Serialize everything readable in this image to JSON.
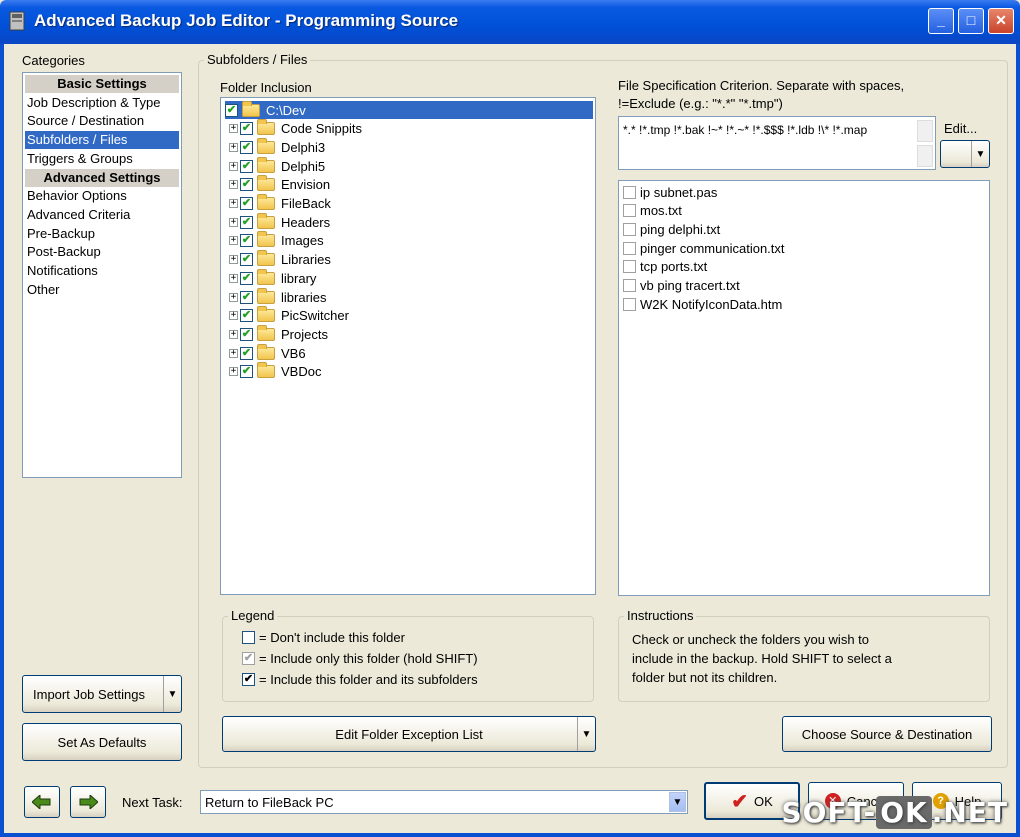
{
  "window": {
    "title": "Advanced Backup Job Editor - Programming Source",
    "minimize_glyph": "_",
    "maximize_glyph": "□",
    "close_glyph": "✕"
  },
  "categories": {
    "label": "Categories",
    "items": [
      {
        "label": "Basic Settings",
        "type": "header"
      },
      {
        "label": "Job Description & Type"
      },
      {
        "label": "Source / Destination"
      },
      {
        "label": "Subfolders / Files",
        "selected": true
      },
      {
        "label": "Triggers & Groups"
      },
      {
        "label": "Advanced Settings",
        "type": "header"
      },
      {
        "label": "Behavior Options"
      },
      {
        "label": "Advanced Criteria"
      },
      {
        "label": "Pre-Backup"
      },
      {
        "label": "Post-Backup"
      },
      {
        "label": "Notifications"
      },
      {
        "label": "Other"
      }
    ]
  },
  "left_buttons": {
    "import_label": "Import Job Settings",
    "defaults_label": "Set As Defaults"
  },
  "subfolders": {
    "group_label": "Subfolders / Files",
    "folder_inclusion_label": "Folder Inclusion",
    "tree": [
      {
        "label": "C:\\Dev",
        "root": true,
        "selected": true
      },
      {
        "label": "Code Snippits"
      },
      {
        "label": "Delphi3"
      },
      {
        "label": "Delphi5"
      },
      {
        "label": "Envision"
      },
      {
        "label": "FileBack"
      },
      {
        "label": "Headers"
      },
      {
        "label": "Images"
      },
      {
        "label": "Libraries"
      },
      {
        "label": "library"
      },
      {
        "label": "libraries"
      },
      {
        "label": "PicSwitcher"
      },
      {
        "label": "Projects"
      },
      {
        "label": "VB6"
      },
      {
        "label": "VBDoc"
      }
    ],
    "file_spec_label_line1": "File Specification Criterion.   Separate with spaces,",
    "file_spec_label_line2": "!=Exclude (e.g.: \"*.*\" \"*.tmp\")",
    "file_spec_value": "*.* !*.tmp !*.bak !~* !*.~* !*.$$$ !*.ldb !\\* !*.map",
    "edit_label": "Edit...",
    "files": [
      "ip subnet.pas",
      "mos.txt",
      "ping delphi.txt",
      "pinger communication.txt",
      "tcp ports.txt",
      "vb ping tracert.txt",
      "W2K NotifyIconData.htm"
    ]
  },
  "legend": {
    "label": "Legend",
    "items": [
      {
        "text": "= Don't include this folder",
        "state": "unchecked"
      },
      {
        "text": "= Include only this folder (hold SHIFT)",
        "state": "gray"
      },
      {
        "text": "= Include this folder and its subfolders",
        "state": "checked"
      }
    ]
  },
  "instructions": {
    "label": "Instructions",
    "line1": "Check or uncheck the folders you wish to",
    "line2": "include in the backup.  Hold SHIFT to select a",
    "line3": "folder but not its children."
  },
  "buttons": {
    "edit_exception": "Edit Folder Exception List",
    "choose_source": "Choose Source & Destination",
    "ok": "OK",
    "cancel": "Cancel",
    "help": "Help"
  },
  "footer": {
    "next_task_label": "Next Task:",
    "next_task_value": "Return to FileBack PC"
  },
  "watermark": {
    "left": "SOFT-",
    "mid": "OK",
    "right": ".NET"
  },
  "colors": {
    "accent": "#316ac5",
    "titlebar": "#0050d8",
    "window_bg": "#ece9d8"
  }
}
